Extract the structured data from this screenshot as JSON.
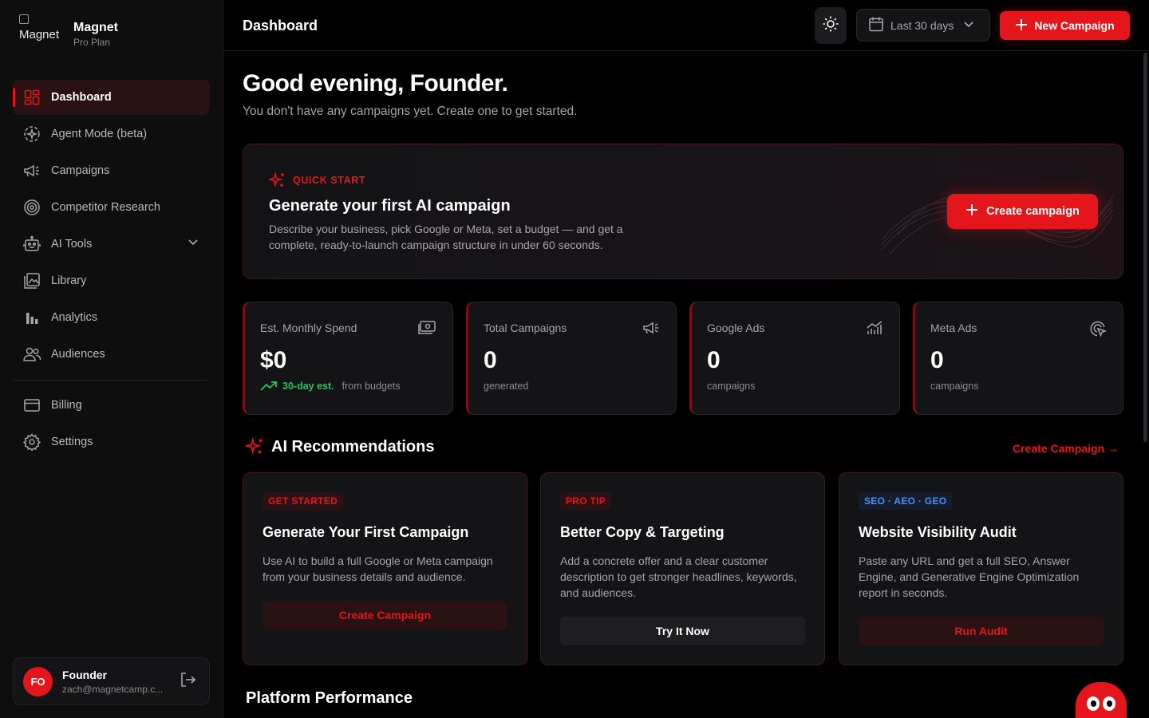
{
  "brand": {
    "logo_alt": "Magnet",
    "name": "Magnet",
    "plan": "Pro Plan"
  },
  "sidebar": {
    "items": [
      {
        "label": "Dashboard",
        "icon": "dashboard-icon"
      },
      {
        "label": "Agent Mode (beta)",
        "icon": "agent-icon"
      },
      {
        "label": "Campaigns",
        "icon": "megaphone-icon"
      },
      {
        "label": "Competitor Research",
        "icon": "target-icon"
      },
      {
        "label": "AI Tools",
        "icon": "robot-icon"
      },
      {
        "label": "Library",
        "icon": "library-icon"
      },
      {
        "label": "Analytics",
        "icon": "bar-chart-icon"
      },
      {
        "label": "Audiences",
        "icon": "users-icon"
      }
    ],
    "secondary": [
      {
        "label": "Billing",
        "icon": "credit-card-icon"
      },
      {
        "label": "Settings",
        "icon": "gear-icon"
      }
    ]
  },
  "user": {
    "initials": "FO",
    "name": "Founder",
    "email": "zach@magnetcamp.c..."
  },
  "header": {
    "title": "Dashboard",
    "date_range": "Last 30 days",
    "new_button": "New Campaign"
  },
  "main": {
    "greeting": "Good evening, Founder.",
    "subtitle": "You don't have any campaigns yet. Create one to get started."
  },
  "quick_start": {
    "tag": "QUICK START",
    "title": "Generate your first AI campaign",
    "description": "Describe your business, pick Google or Meta, set a budget — and get a complete, ready-to-launch campaign structure in under 60 seconds.",
    "button": "Create campaign"
  },
  "stats": [
    {
      "label": "Est. Monthly Spend",
      "value": "$0",
      "trend": "30-day est.",
      "sub": "from budgets"
    },
    {
      "label": "Total Campaigns",
      "value": "0",
      "sub": "generated"
    },
    {
      "label": "Google Ads",
      "value": "0",
      "sub": "campaigns"
    },
    {
      "label": "Meta Ads",
      "value": "0",
      "sub": "campaigns"
    }
  ],
  "recommendations": {
    "heading": "AI Recommendations",
    "link": "Create Campaign →",
    "cards": [
      {
        "tag": "GET STARTED",
        "title": "Generate Your First Campaign",
        "description": "Use AI to build a full Google or Meta campaign from your business details and audience.",
        "button": "Create Campaign"
      },
      {
        "tag": "PRO TIP",
        "title": "Better Copy & Targeting",
        "description": "Add a concrete offer and a clear customer description to get stronger headlines, keywords, and audiences.",
        "button": "Try It Now"
      },
      {
        "tag": "SEO · AEO · GEO",
        "title": "Website Visibility Audit",
        "description": "Paste any URL and get a full SEO, Answer Engine, and Generative Engine Optimization report in seconds.",
        "button": "Run Audit"
      }
    ]
  },
  "performance": {
    "heading": "Platform Performance"
  },
  "colors": {
    "accent": "#e5161b",
    "background": "#000000",
    "surface": "#141416",
    "positive": "#22c55e",
    "info": "#4d8ff0"
  }
}
